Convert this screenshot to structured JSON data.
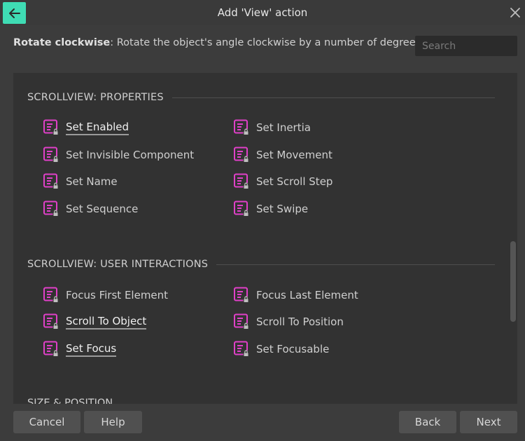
{
  "window": {
    "title": "Add 'View' action"
  },
  "description": {
    "action": "Rotate clockwise",
    "text": ": Rotate the object's angle clockwise by a number of degrees."
  },
  "search": {
    "placeholder": "Search",
    "value": ""
  },
  "sections": [
    {
      "title": "SCROLLVIEW: PROPERTIES",
      "items": [
        {
          "label": "Set Enabled",
          "highlighted": true
        },
        {
          "label": "Set Inertia",
          "highlighted": false
        },
        {
          "label": "Set Invisible Component",
          "highlighted": false
        },
        {
          "label": "Set Movement",
          "highlighted": false
        },
        {
          "label": "Set Name",
          "highlighted": false
        },
        {
          "label": "Set Scroll Step",
          "highlighted": false
        },
        {
          "label": "Set Sequence",
          "highlighted": false
        },
        {
          "label": "Set Swipe",
          "highlighted": false
        }
      ]
    },
    {
      "title": "SCROLLVIEW: USER INTERACTIONS",
      "items": [
        {
          "label": "Focus First Element",
          "highlighted": false
        },
        {
          "label": "Focus Last Element",
          "highlighted": false
        },
        {
          "label": "Scroll To Object",
          "highlighted": true
        },
        {
          "label": "Scroll To Position",
          "highlighted": false
        },
        {
          "label": "Set Focus",
          "highlighted": true
        },
        {
          "label": "Set Focusable",
          "highlighted": false
        }
      ]
    },
    {
      "title": "SIZE & POSITION",
      "items": []
    }
  ],
  "buttons": {
    "cancel": "Cancel",
    "help": "Help",
    "back": "Back",
    "next": "Next"
  },
  "icons": {
    "back": "arrow-left-icon",
    "close": "close-icon",
    "action": "action-lock-icon"
  },
  "colors": {
    "accent": "#3fdcb4",
    "action_icon": "#e040c8"
  }
}
